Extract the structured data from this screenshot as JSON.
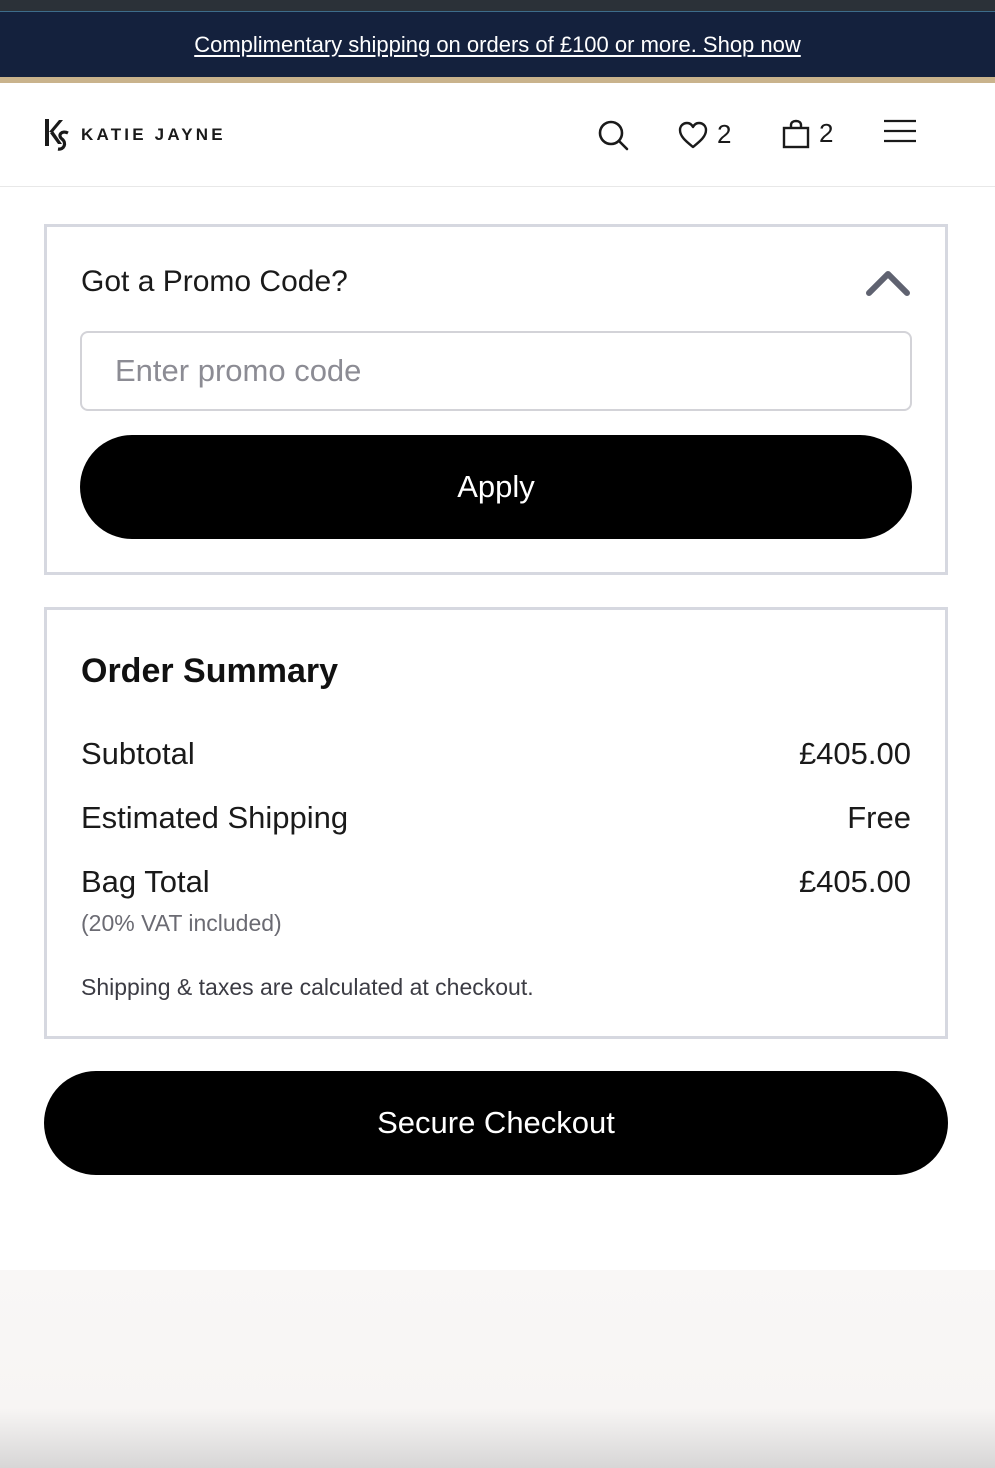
{
  "announcement": {
    "text": "Complimentary shipping on orders of £100 or more. Shop now",
    "bg_color": "#14213d",
    "accent_line_color": "#c9b38c"
  },
  "header": {
    "logo_text": "KATIE JAYNE",
    "logo_mark_icon": "ks-monogram-icon",
    "search_icon": "search-icon",
    "wishlist_icon": "heart-icon",
    "wishlist_count": "2",
    "bag_icon": "shopping-bag-icon",
    "bag_count": "2",
    "menu_icon": "hamburger-menu-icon"
  },
  "promo": {
    "title": "Got a Promo Code?",
    "toggle_icon": "chevron-up-icon",
    "input_value": "",
    "input_placeholder": "Enter promo code",
    "apply_label": "Apply"
  },
  "order_summary": {
    "title": "Order Summary",
    "rows": [
      {
        "label": "Subtotal",
        "value": "£405.00"
      },
      {
        "label": "Estimated Shipping",
        "value": "Free"
      },
      {
        "label": "Bag Total",
        "value": "£405.00"
      }
    ],
    "vat_note": "(20% VAT included)",
    "taxes_note": "Shipping & taxes are calculated at checkout."
  },
  "checkout": {
    "label": "Secure Checkout"
  }
}
